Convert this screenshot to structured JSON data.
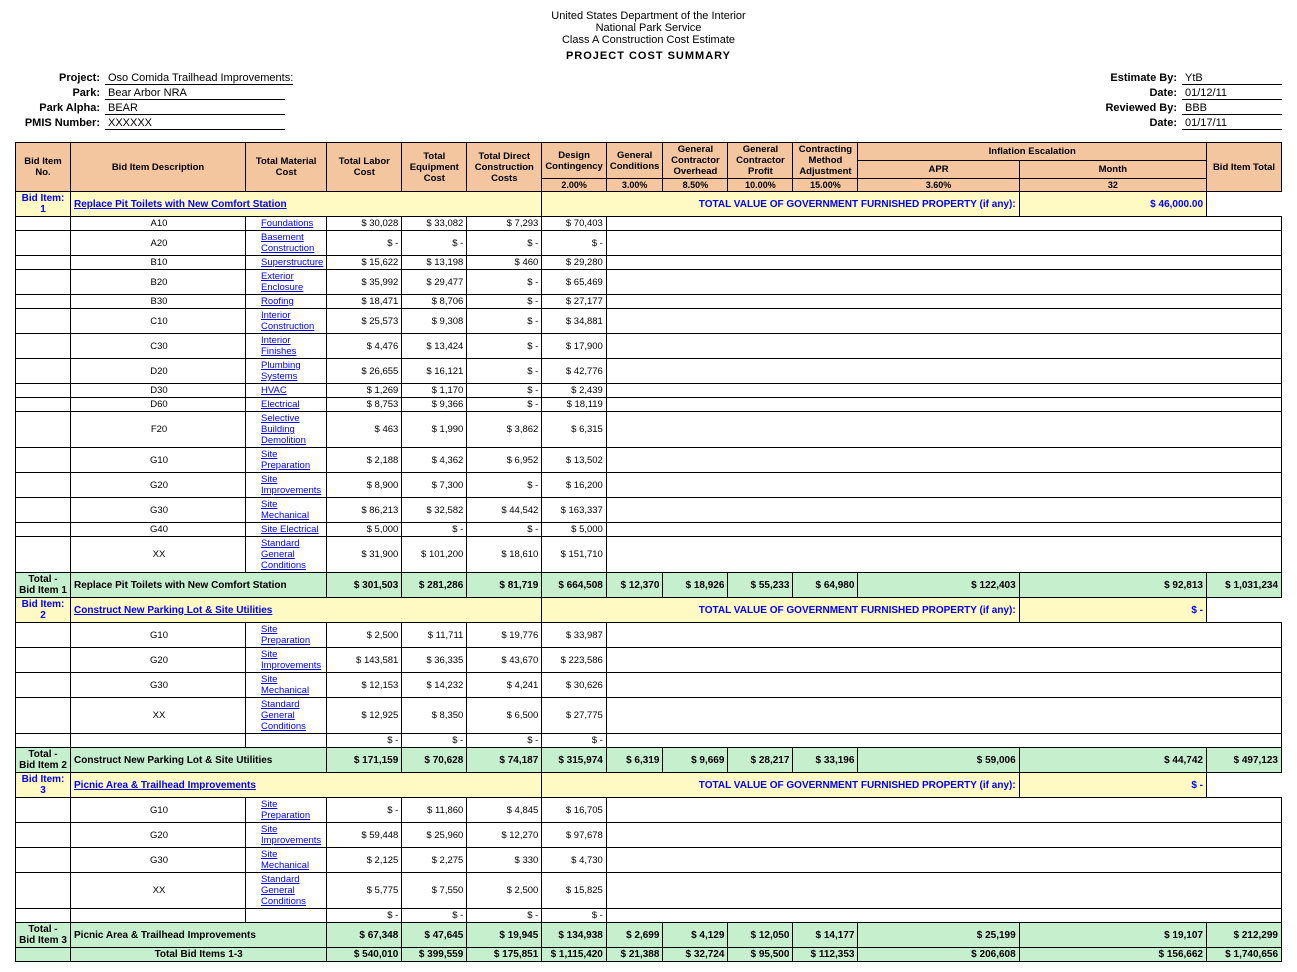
{
  "header": {
    "line1": "United States Department of the Interior",
    "line2": "National Park Service",
    "line3": "Class A Construction Cost Estimate",
    "title": "PROJECT COST SUMMARY"
  },
  "meta": {
    "project_label": "Project:",
    "project_value": "Oso Comida Trailhead Improvements:",
    "park_label": "Park:",
    "park_value": "Bear Arbor NRA",
    "park_alpha_label": "Park Alpha:",
    "park_alpha_value": "BEAR",
    "pmis_label": "PMIS Number:",
    "pmis_value": "XXXXXX",
    "estimate_by_label": "Estimate By:",
    "estimate_by_value": "YtB",
    "date1_label": "Date:",
    "date1_value": "01/12/11",
    "reviewed_by_label": "Reviewed By:",
    "reviewed_by_value": "BBB",
    "date2_label": "Date:",
    "date2_value": "01/17/11"
  },
  "table": {
    "col_headers": {
      "bid_no": "Bid Item No.",
      "desc": "Bid Item Description",
      "mat": "Total Material Cost",
      "labor": "Total Labor Cost",
      "equip": "Total Equipment Cost",
      "direct": "Total Direct Construction Costs",
      "design": "Design Contingency",
      "gcond": "General Conditions",
      "gcoh": "General Contractor Overhead",
      "gcprof": "General Contractor Profit",
      "cma": "Contracting Method Adjustment",
      "infl": "Inflation Escalation",
      "total": "Bid Item Total"
    },
    "pct": {
      "design": "2.00%",
      "gcond": "3.00%",
      "gcoh": "8.50%",
      "gcprof": "10.00%",
      "cma": "15.00%",
      "apr": "3.60%",
      "month": "32"
    },
    "infl_sub": {
      "apr": "APR",
      "month": "Month"
    },
    "bid1": {
      "number": "1",
      "title": "Replace Pit Toilets with New Comfort Station",
      "gov_prop_label": "TOTAL VALUE OF GOVERNMENT FURNISHED PROPERTY (if any):",
      "gov_prop_value": "$ 46,000.00",
      "items": [
        {
          "code": "A10",
          "desc": "Foundations",
          "mat": "$ 30,028",
          "labor": "$ 33,082",
          "equip": "$ 7,293",
          "direct": "$ 70,403"
        },
        {
          "code": "A20",
          "desc": "Basement Construction",
          "mat": "$         -",
          "labor": "$         -",
          "equip": "$         -",
          "direct": "$         -"
        },
        {
          "code": "B10",
          "desc": "Superstructure",
          "mat": "$ 15,622",
          "labor": "$ 13,198",
          "equip": "$       460",
          "direct": "$ 29,280"
        },
        {
          "code": "B20",
          "desc": "Exterior Enclosure",
          "mat": "$ 35,992",
          "labor": "$ 29,477",
          "equip": "$         -",
          "direct": "$ 65,469"
        },
        {
          "code": "B30",
          "desc": "Roofing",
          "mat": "$ 18,471",
          "labor": "$   8,706",
          "equip": "$         -",
          "direct": "$ 27,177"
        },
        {
          "code": "C10",
          "desc": "Interior Construction",
          "mat": "$ 25,573",
          "labor": "$   9,308",
          "equip": "$         -",
          "direct": "$ 34,881"
        },
        {
          "code": "C30",
          "desc": "Interior Finishes",
          "mat": "$   4,476",
          "labor": "$ 13,424",
          "equip": "$         -",
          "direct": "$ 17,900"
        },
        {
          "code": "D20",
          "desc": "Plumbing Systems",
          "mat": "$ 26,655",
          "labor": "$ 16,121",
          "equip": "$         -",
          "direct": "$ 42,776"
        },
        {
          "code": "D30",
          "desc": "HVAC",
          "mat": "$   1,269",
          "labor": "$   1,170",
          "equip": "$         -",
          "direct": "$   2,439"
        },
        {
          "code": "D60",
          "desc": "Electrical",
          "mat": "$   8,753",
          "labor": "$   9,366",
          "equip": "$         -",
          "direct": "$ 18,119"
        },
        {
          "code": "F20",
          "desc": "Selective Building Demolition",
          "mat": "$       463",
          "labor": "$   1,990",
          "equip": "$   3,862",
          "direct": "$   6,315"
        },
        {
          "code": "G10",
          "desc": "Site Preparation",
          "mat": "$   2,188",
          "labor": "$   4,362",
          "equip": "$   6,952",
          "direct": "$ 13,502"
        },
        {
          "code": "G20",
          "desc": "Site Improvements",
          "mat": "$   8,900",
          "labor": "$   7,300",
          "equip": "$         -",
          "direct": "$ 16,200"
        },
        {
          "code": "G30",
          "desc": "Site Mechanical",
          "mat": "$ 86,213",
          "labor": "$ 32,582",
          "equip": "$ 44,542",
          "direct": "$ 163,337"
        },
        {
          "code": "G40",
          "desc": "Site Electrical",
          "mat": "$   5,000",
          "labor": "$         -",
          "equip": "$         -",
          "direct": "$   5,000"
        },
        {
          "code": "XX",
          "desc": "Standard General Conditions",
          "mat": "$ 31,900",
          "labor": "$ 101,200",
          "equip": "$ 18,610",
          "direct": "$ 151,710"
        }
      ],
      "total": {
        "label": "Replace Pit Toilets with New Comfort Station",
        "mat": "$ 301,503",
        "labor": "$ 281,286",
        "equip": "$ 81,719",
        "direct": "$ 664,508",
        "design": "$ 12,370",
        "gcond": "$ 18,926",
        "gcoh": "$ 55,233",
        "gcprof": "$ 64,980",
        "cma": "$ 122,403",
        "infl": "$ 92,813",
        "total": "$ 1,031,234"
      }
    },
    "bid2": {
      "number": "2",
      "title": "Construct New Parking Lot & Site Utilities",
      "gov_prop_label": "TOTAL VALUE OF GOVERNMENT FURNISHED PROPERTY (if any):",
      "gov_prop_value": "$ -",
      "items": [
        {
          "code": "G10",
          "desc": "Site Preparation",
          "mat": "$   2,500",
          "labor": "$ 11,711",
          "equip": "$ 19,776",
          "direct": "$ 33,987"
        },
        {
          "code": "G20",
          "desc": "Site Improvements",
          "mat": "$ 143,581",
          "labor": "$ 36,335",
          "equip": "$ 43,670",
          "direct": "$ 223,586"
        },
        {
          "code": "G30",
          "desc": "Site Mechanical",
          "mat": "$ 12,153",
          "labor": "$ 14,232",
          "equip": "$   4,241",
          "direct": "$ 30,626"
        },
        {
          "code": "XX",
          "desc": "Standard General Conditions",
          "mat": "$ 12,925",
          "labor": "$   8,350",
          "equip": "$   6,500",
          "direct": "$ 27,775"
        },
        {
          "code": "",
          "desc": "",
          "mat": "$         -",
          "labor": "$         -",
          "equip": "$         -",
          "direct": "$         -"
        }
      ],
      "total": {
        "label": "Construct New Parking Lot & Site Utilities",
        "mat": "$ 171,159",
        "labor": "$ 70,628",
        "equip": "$ 74,187",
        "direct": "$ 315,974",
        "design": "$ 6,319",
        "gcond": "$ 9,669",
        "gcoh": "$ 28,217",
        "gcprof": "$ 33,196",
        "cma": "$ 59,006",
        "infl": "$ 44,742",
        "total": "$ 497,123"
      }
    },
    "bid3": {
      "number": "3",
      "title": "Picnic Area & Trailhead Improvements",
      "gov_prop_label": "TOTAL VALUE OF GOVERNMENT FURNISHED PROPERTY (if any):",
      "gov_prop_value": "$ -",
      "items": [
        {
          "code": "G10",
          "desc": "Site Preparation",
          "mat": "$         -",
          "labor": "$ 11,860",
          "equip": "$   4,845",
          "direct": "$ 16,705"
        },
        {
          "code": "G20",
          "desc": "Site Improvements",
          "mat": "$ 59,448",
          "labor": "$ 25,960",
          "equip": "$ 12,270",
          "direct": "$ 97,678"
        },
        {
          "code": "G30",
          "desc": "Site Mechanical",
          "mat": "$   2,125",
          "labor": "$   2,275",
          "equip": "$       330",
          "direct": "$   4,730"
        },
        {
          "code": "XX",
          "desc": "Standard General Conditions",
          "mat": "$   5,775",
          "labor": "$   7,550",
          "equip": "$   2,500",
          "direct": "$ 15,825"
        },
        {
          "code": "",
          "desc": "",
          "mat": "$         -",
          "labor": "$         -",
          "equip": "$         -",
          "direct": "$         -"
        }
      ],
      "total": {
        "label": "Picnic Area & Trailhead Improvements",
        "mat": "$ 67,348",
        "labor": "$ 47,645",
        "equip": "$ 19,945",
        "direct": "$ 134,938",
        "design": "$ 2,699",
        "gcond": "$ 4,129",
        "gcoh": "$ 12,050",
        "gcprof": "$ 14,177",
        "cma": "$ 25,199",
        "infl": "$ 19,107",
        "total": "$ 212,299"
      }
    },
    "grand_total": {
      "label": "Total Bid Items 1-3",
      "mat": "$ 540,010",
      "labor": "$ 399,559",
      "equip": "$ 175,851",
      "direct": "$ 1,115,420",
      "design": "$ 21,388",
      "gcond": "$ 32,724",
      "gcoh": "$ 95,500",
      "gcprof": "$ 112,353",
      "cma": "$ 206,608",
      "infl": "$ 156,662",
      "total": "$ 1,740,656"
    }
  }
}
